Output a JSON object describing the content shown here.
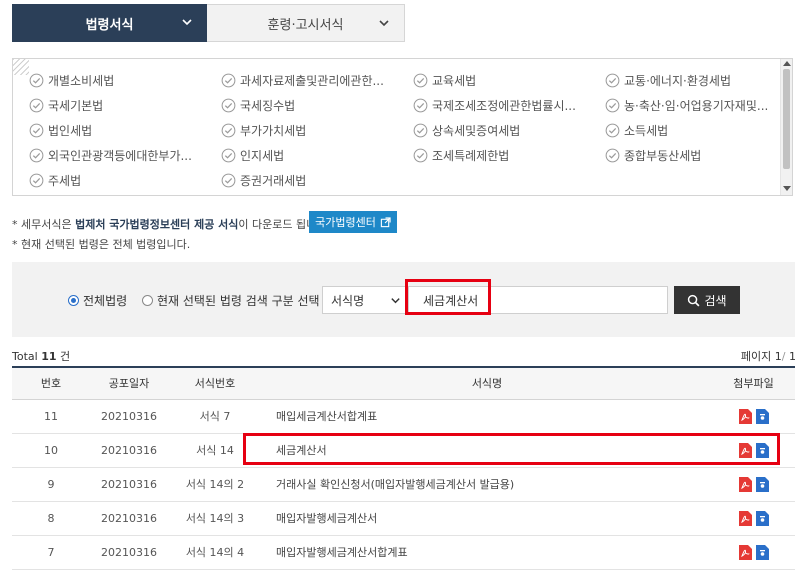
{
  "tabs": [
    {
      "label": "법령서식",
      "active": true
    },
    {
      "label": "훈령·고시서식",
      "active": false
    }
  ],
  "laws": [
    "개별소비세법",
    "과세자료제출및관리에관한...",
    "교육세법",
    "교통·에너지·환경세법",
    "국세기본법",
    "국세징수법",
    "국제조세조정에관한법률시...",
    "농·축산·임·어업용기자재및...",
    "법인세법",
    "부가가치세법",
    "상속세및증여세법",
    "소득세법",
    "외국인관광객등에대한부가...",
    "인지세법",
    "조세특례제한법",
    "종합부동산세법",
    "주세법",
    "증권거래세법"
  ],
  "notices": {
    "line1_prefix": "* 세무서식은 ",
    "line1_bold": "법제처 국가법령정보센터 제공 서식",
    "line1_suffix": "이 다운로드 됩니다.",
    "line2": "* 현재 선택된 법령은 전체 법령입니다.",
    "law_center_button": "국가법령센터"
  },
  "search": {
    "radio_all": "전체법령",
    "radio_selected": "현재 선택된 법령 검색 구분 선택",
    "select_value": "서식명",
    "input_value": "세금계산서",
    "button_label": "검색"
  },
  "summary": {
    "total_prefix": "Total",
    "total_count": "11",
    "total_unit": "건",
    "page_label": "페이지",
    "page_current": "1",
    "page_sep": "/",
    "page_total": "1"
  },
  "table": {
    "headers": [
      "번호",
      "공포일자",
      "서식번호",
      "서식명",
      "첨부파일"
    ],
    "rows": [
      {
        "no": "11",
        "date": "20210316",
        "form": "서식 7",
        "name": "매입세금계산서합계표"
      },
      {
        "no": "10",
        "date": "20210316",
        "form": "서식 14",
        "name": "세금계산서"
      },
      {
        "no": "9",
        "date": "20210316",
        "form": "서식 14의 2",
        "name": "거래사실 확인신청서(매입자발행세금계산서 발급용)"
      },
      {
        "no": "8",
        "date": "20210316",
        "form": "서식 14의 3",
        "name": "매입자발행세금계산서"
      },
      {
        "no": "7",
        "date": "20210316",
        "form": "서식 14의 4",
        "name": "매입자발행세금계산서합계표"
      }
    ]
  },
  "colors": {
    "navy": "#2b3f58",
    "highlight": "#e60012",
    "link_blue": "#1e88c8",
    "pdf_red": "#e53935",
    "hwp_blue": "#2a6fc9"
  },
  "icons": {
    "check": "circle-check-icon",
    "chevron": "chevron-down-icon",
    "external": "external-link-icon",
    "search": "magnifier-icon",
    "pdf": "pdf-file-icon",
    "hwp": "hwp-file-icon"
  }
}
